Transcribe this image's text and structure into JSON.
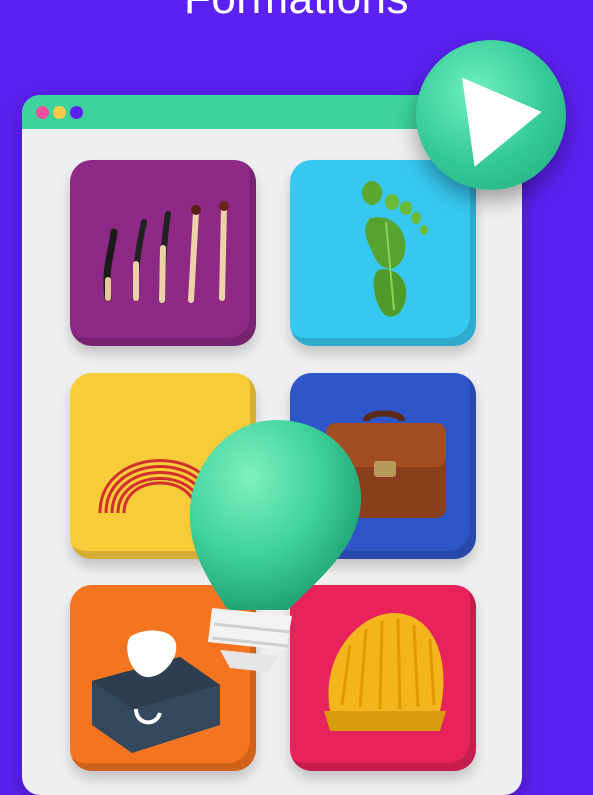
{
  "header": {
    "title": "Formations"
  },
  "window": {
    "background": "#efeff1",
    "bar_color": "#3ed39c",
    "dot_colors": [
      "#f04fa0",
      "#f7c948",
      "#5b21f0"
    ]
  },
  "play": {
    "icon": "play-icon",
    "color": "#33c996"
  },
  "tiles": [
    {
      "icon": "burning-matches-icon",
      "color": "#8e2a86"
    },
    {
      "icon": "leaf-footprint-icon",
      "color": "#37c8f2"
    },
    {
      "icon": "coil-spring-icon",
      "color": "#f9cc3a"
    },
    {
      "icon": "briefcase-icon",
      "color": "#2f56c8"
    },
    {
      "icon": "tissue-box-icon",
      "color": "#f5741f"
    },
    {
      "icon": "hard-hat-icon",
      "color": "#e8235c"
    }
  ],
  "overlay": {
    "icon": "lightbulb-icon",
    "color": "#3fd29a"
  }
}
